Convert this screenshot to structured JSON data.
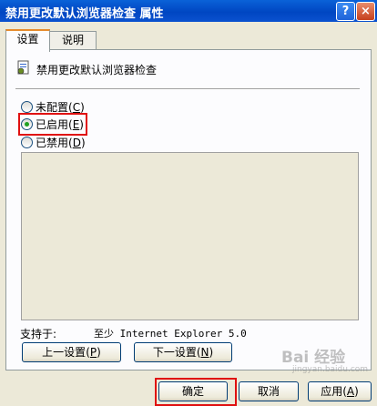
{
  "window": {
    "title": "禁用更改默认浏览器检查 属性",
    "help_glyph": "?",
    "close_glyph": "×"
  },
  "tabs": [
    {
      "label": "设置",
      "active": true
    },
    {
      "label": "说明",
      "active": false
    }
  ],
  "policy": {
    "icon": "policy-setting-icon",
    "name": "禁用更改默认浏览器检查"
  },
  "radios": [
    {
      "label": "未配置",
      "key": "C",
      "checked": false
    },
    {
      "label": "已启用",
      "key": "E",
      "checked": true
    },
    {
      "label": "已禁用",
      "key": "D",
      "checked": false
    }
  ],
  "support": {
    "label": "支持于:",
    "value": "至少 Internet Explorer 5.0"
  },
  "nav_buttons": {
    "prev_label": "上一设置",
    "prev_key": "P",
    "next_label": "下一设置",
    "next_key": "N"
  },
  "footer": {
    "ok_label": "确定",
    "cancel_label": "取消",
    "apply_label": "应用",
    "apply_key": "A"
  },
  "watermark": {
    "line1": "Bai 经验",
    "line2": "jingyan.baidu.com"
  },
  "colors": {
    "highlight": "#e01010",
    "titlebar": "#0046c2"
  }
}
